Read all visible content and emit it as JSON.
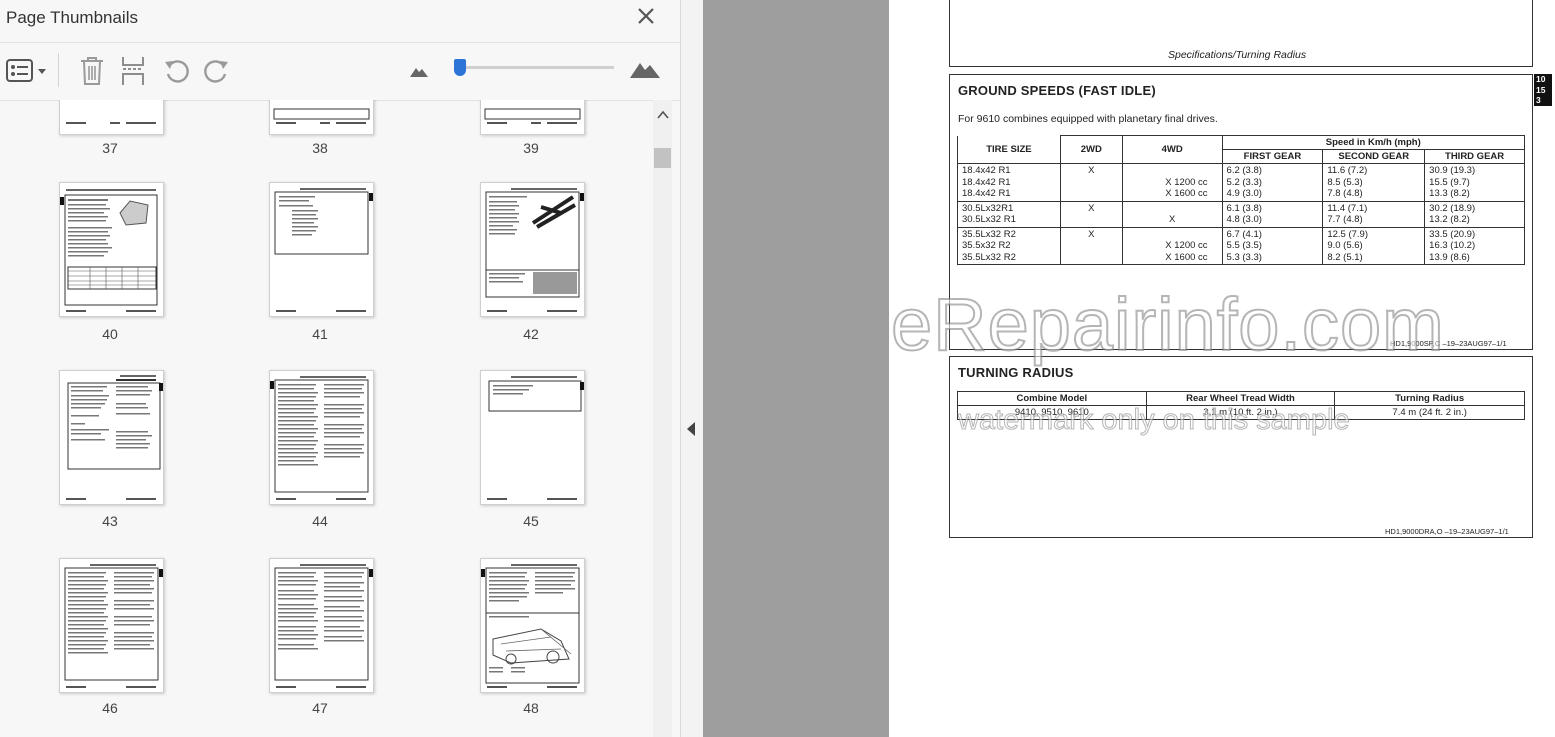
{
  "sidebar": {
    "title": "Page Thumbnails",
    "thumbnail_labels": [
      "37",
      "38",
      "39",
      "40",
      "41",
      "42",
      "43",
      "44",
      "45",
      "46",
      "47",
      "48"
    ]
  },
  "document": {
    "header_caption": "Specifications/Turning Radius",
    "side_tab": [
      "10",
      "15",
      "3"
    ],
    "ground_speeds": {
      "title": "GROUND SPEEDS (FAST IDLE)",
      "intro": "For 9610 combines equipped with planetary final drives.",
      "headers": {
        "tire_size": "TIRE SIZE",
        "two_wd": "2WD",
        "four_wd": "4WD",
        "speed_group": "Speed in Km/h (mph)",
        "first_gear": "FIRST GEAR",
        "second_gear": "SECOND GEAR",
        "third_gear": "THIRD GEAR"
      },
      "groups": [
        {
          "tire": [
            "18.4x42 R1",
            "18.4x42 R1",
            "18.4x42 R1"
          ],
          "two_wd": [
            "X",
            "",
            ""
          ],
          "four_wd": [
            "",
            "X 1200 cc",
            "X 1600 cc"
          ],
          "first": [
            "6.2 (3.8)",
            "5.2 (3.3)",
            "4.9 (3.0)"
          ],
          "second": [
            "11.6 (7.2)",
            "8.5 (5.3)",
            "7.8 (4.8)"
          ],
          "third": [
            "30.9 (19.3)",
            "15.5 (9.7)",
            "13.3 (8.2)"
          ]
        },
        {
          "tire": [
            "30.5Lx32R1",
            "30.5Lx32 R1"
          ],
          "two_wd": [
            "X",
            ""
          ],
          "four_wd": [
            "",
            "X"
          ],
          "first": [
            "6.1 (3.8)",
            "4.8 (3.0)"
          ],
          "second": [
            "11.4 (7.1)",
            "7.7 (4.8)"
          ],
          "third": [
            "30.2 (18.9)",
            "13.2 (8.2)"
          ]
        },
        {
          "tire": [
            "35.5Lx32 R2",
            "35.5x32 R2",
            "35.5Lx32 R2"
          ],
          "two_wd": [
            "X",
            "",
            ""
          ],
          "four_wd": [
            "",
            "X 1200 cc",
            "X 1600 cc"
          ],
          "first": [
            "6.7 (4.1)",
            "5.5 (3.5)",
            "5.3 (3.3)"
          ],
          "second": [
            "12.5 (7.9)",
            "9.0 (5.6)",
            "8.2 (5.1)"
          ],
          "third": [
            "33.5 (20.9)",
            "16.3 (10.2)",
            "13.9 (8.6)"
          ]
        }
      ],
      "ref_code": "HD1,9000SP,C  –19–23AUG97–1/1"
    },
    "turning_radius": {
      "title": "TURNING RADIUS",
      "headers": [
        "Combine Model",
        "Rear Wheel Tread Width",
        "Turning Radius"
      ],
      "row": [
        "9410, 9510, 9610",
        "3.1 m (10 ft. 2 in.)",
        "7.4 m (24 ft. 2 in.)"
      ],
      "ref_code": "HD1,9000DRA,O  –19–23AUG97–1/1"
    },
    "watermark_main": "eRepairinfo.com",
    "watermark_sub": "watermark only on this sample"
  },
  "colors": {
    "accent": "#2d74d6",
    "viewer_gray": "#9e9e9e",
    "panel_bg": "#f7f7f7"
  }
}
